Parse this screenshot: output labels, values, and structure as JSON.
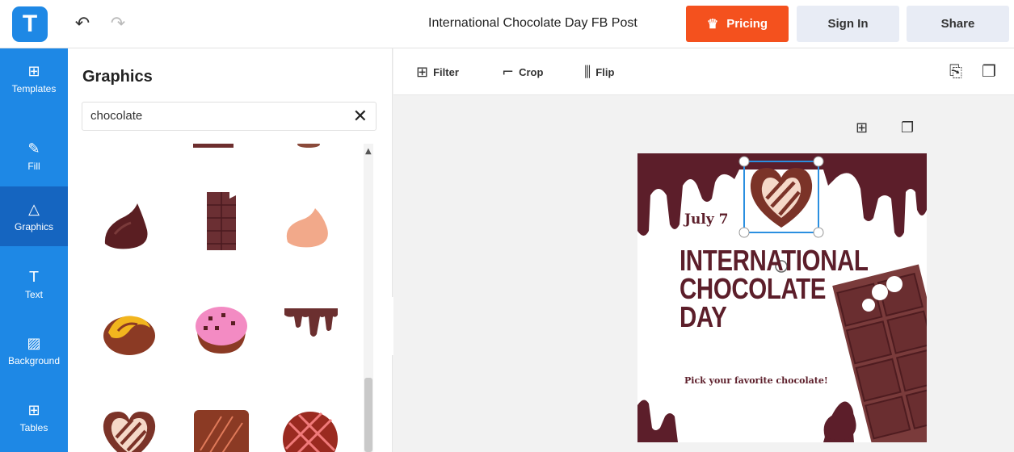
{
  "app": {
    "logo_letter": "T",
    "undo_icon": "undo-icon",
    "redo_icon": "redo-icon",
    "document_title": "International Chocolate Day FB Post"
  },
  "header": {
    "pricing_label": "Pricing",
    "signin_label": "Sign In",
    "share_label": "Share",
    "accent_color": "#f4511e"
  },
  "sidebar": {
    "items": [
      {
        "label": "Templates",
        "icon": "templates-icon"
      },
      {
        "label": "Fill",
        "icon": "pencil-icon"
      },
      {
        "label": "Graphics",
        "icon": "shapes-icon",
        "active": true
      },
      {
        "label": "Text",
        "icon": "text-icon"
      },
      {
        "label": "Background",
        "icon": "background-icon"
      },
      {
        "label": "Tables",
        "icon": "table-icon"
      }
    ]
  },
  "panel": {
    "title": "Graphics",
    "search": {
      "value": "chocolate"
    }
  },
  "toolbar": {
    "filter_label": "Filter",
    "crop_label": "Crop",
    "flip_label": "Flip"
  },
  "design": {
    "date": "July 7",
    "title_lines": [
      "INTERNATIONAL",
      "CHOCOLATE",
      "DAY"
    ],
    "subtitle": "Pick your favorite chocolate!",
    "brand_color": "#5c1e2a"
  }
}
